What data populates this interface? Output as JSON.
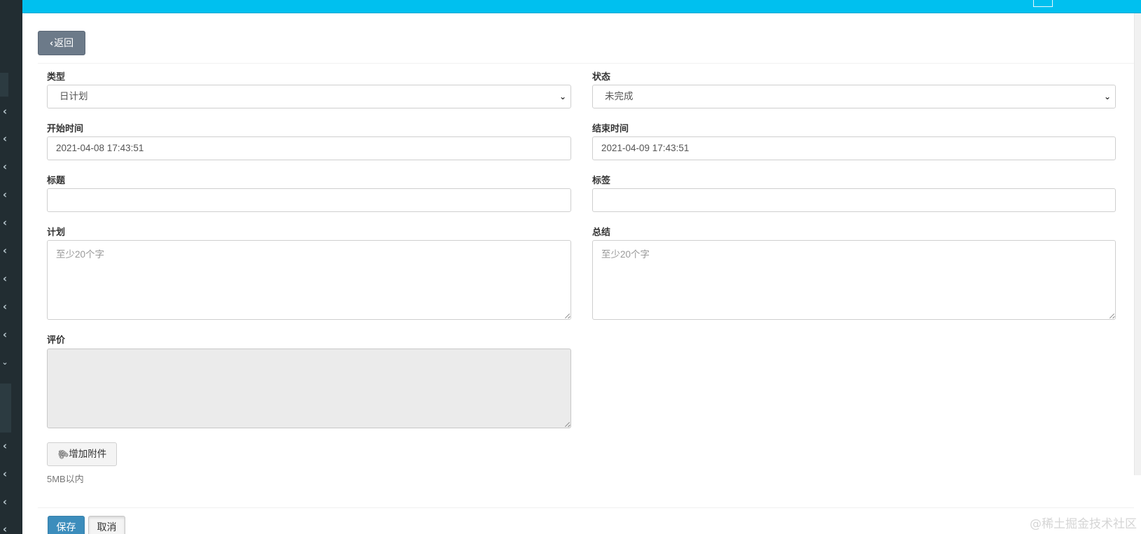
{
  "colors": {
    "topbar": "#00c0ef",
    "sidebar": "#222d32",
    "primary": "#3c8dbc",
    "back_button": "#6c7a89"
  },
  "sidebar": {
    "chevron_icon": "chevron-left-icon",
    "expanded_icon": "chevron-down-icon"
  },
  "back_button": {
    "icon": "chevron-left-icon",
    "label": "返回"
  },
  "form": {
    "type": {
      "label": "类型",
      "value": "日计划"
    },
    "status": {
      "label": "状态",
      "value": "未完成"
    },
    "start_time": {
      "label": "开始时间",
      "value": "2021-04-08 17:43:51"
    },
    "end_time": {
      "label": "结束时间",
      "value": "2021-04-09 17:43:51"
    },
    "title": {
      "label": "标题",
      "value": ""
    },
    "tags": {
      "label": "标签",
      "value": ""
    },
    "plan": {
      "label": "计划",
      "placeholder": "至少20个字"
    },
    "summary": {
      "label": "总结",
      "placeholder": "至少20个字"
    },
    "evaluation": {
      "label": "评价",
      "value": ""
    },
    "attachment": {
      "icon": "paperclip-icon",
      "label": "增加附件",
      "hint": "5MB以内"
    }
  },
  "actions": {
    "save_label": "保存",
    "cancel_label": "取消"
  },
  "watermark": "@稀土掘金技术社区"
}
